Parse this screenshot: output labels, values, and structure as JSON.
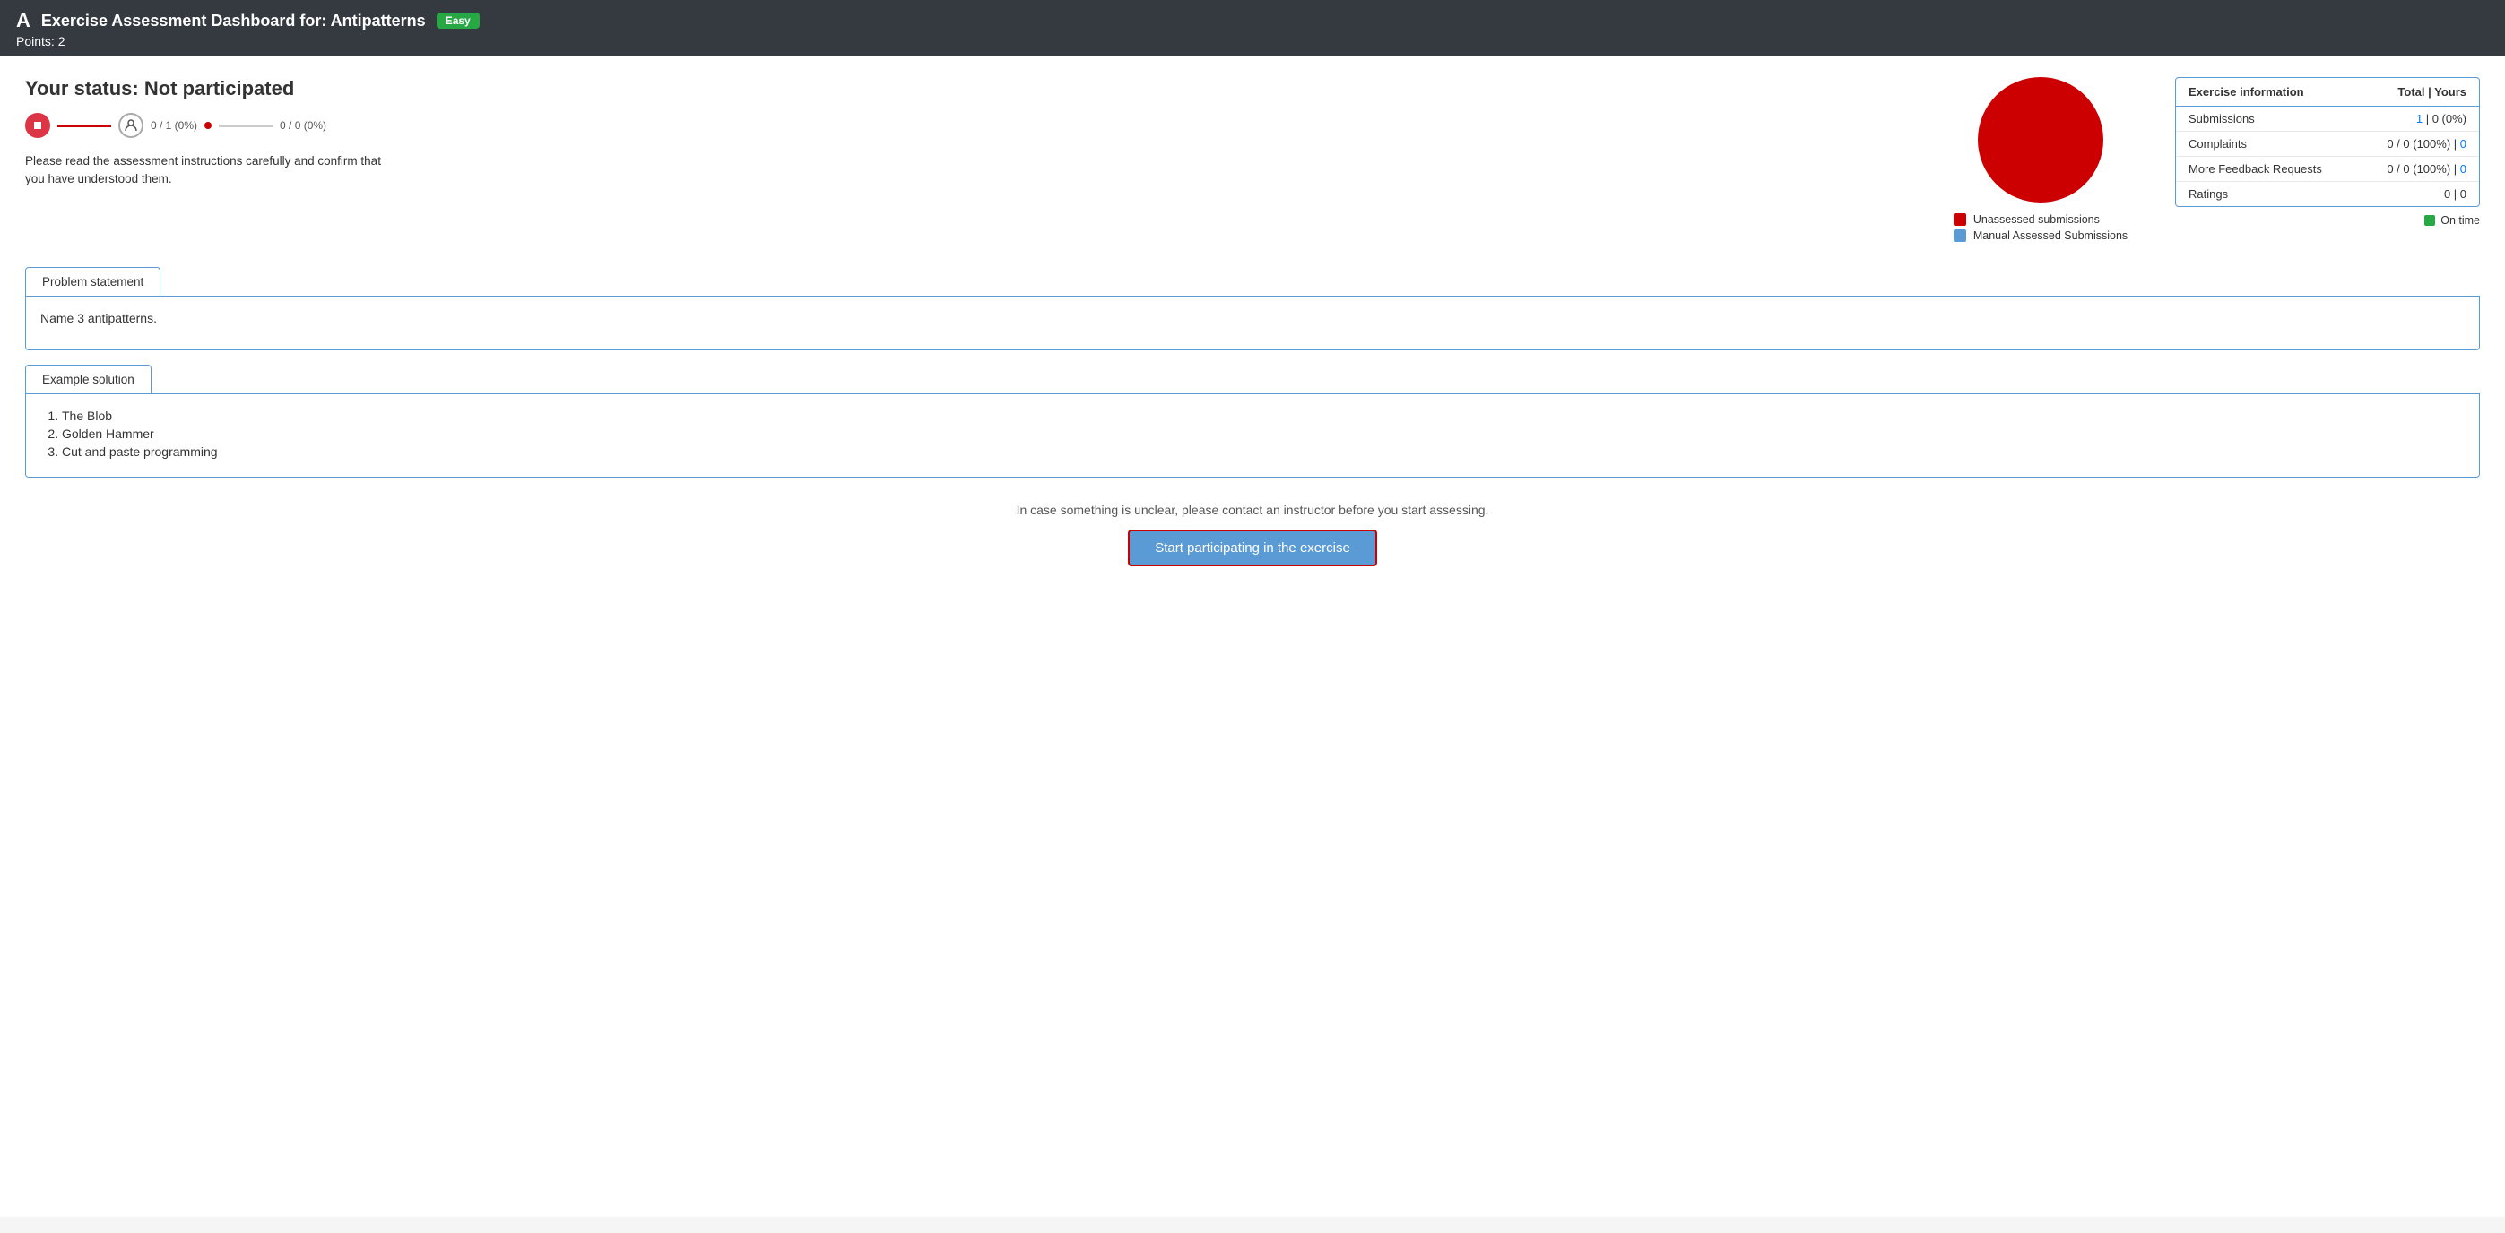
{
  "header": {
    "logo": "A",
    "title": "Exercise Assessment Dashboard for: Antipatterns",
    "badge": "Easy",
    "points_label": "Points: 2"
  },
  "status": {
    "title": "Your status: Not participated",
    "progress1_label": "0 / 1 (0%)",
    "progress2_label": "0 / 0 (0%)",
    "instructions": "Please read the assessment instructions carefully and confirm that you have understood them."
  },
  "chart": {
    "legend": [
      {
        "type": "box-red",
        "label": "Unassessed submissions"
      },
      {
        "type": "box-blue",
        "label": "Manual Assessed Submissions"
      }
    ]
  },
  "info_table": {
    "col1": "Exercise information",
    "col2": "Total | Yours",
    "rows": [
      {
        "label": "Submissions",
        "value": "1 | 0 (0%)"
      },
      {
        "label": "Complaints",
        "value": "0 / 0 (100%) | 0"
      },
      {
        "label": "More Feedback Requests",
        "value": "0 / 0 (100%) | 0"
      },
      {
        "label": "Ratings",
        "value": "0 | 0"
      }
    ],
    "on_time": "On time"
  },
  "problem_statement": {
    "tab_label": "Problem statement",
    "content": "Name 3 antipatterns."
  },
  "example_solution": {
    "tab_label": "Example solution",
    "items": [
      "The Blob",
      "Golden Hammer",
      "Cut and paste programming"
    ]
  },
  "bottom": {
    "contact_text": "In case something is unclear, please contact an instructor before you start assessing.",
    "start_button": "Start participating in the exercise"
  }
}
